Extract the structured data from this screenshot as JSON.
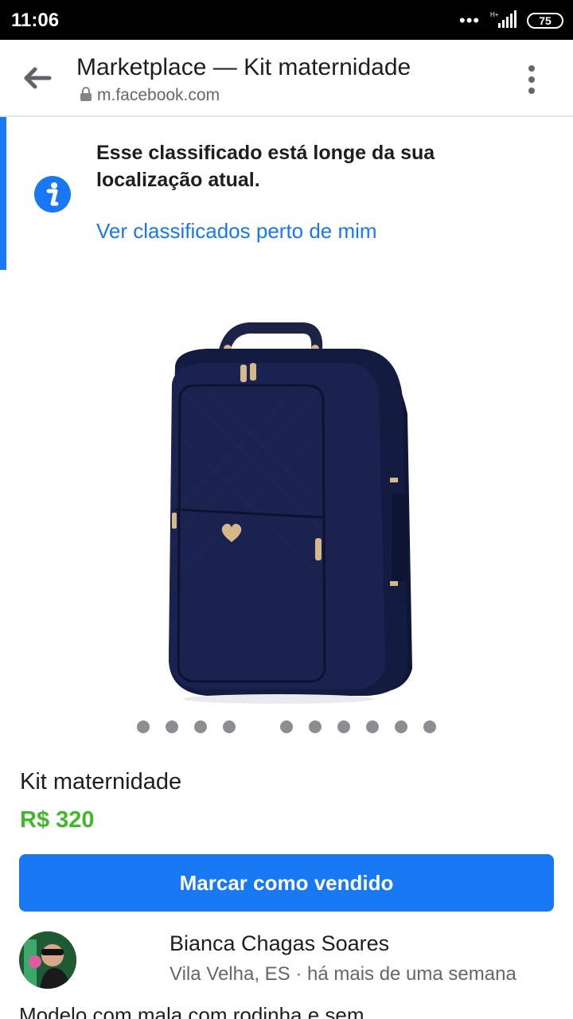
{
  "status": {
    "time": "11:06",
    "dots": "•••",
    "network": "H+",
    "battery": "75"
  },
  "header": {
    "title": "Marketplace — Kit maternidade",
    "url": "m.facebook.com",
    "back_icon": "arrow-left-icon",
    "more_icon": "more-vertical-icon"
  },
  "notice": {
    "text": "Esse classificado está longe da sua localização atual.",
    "link": "Ver classificados perto de mim",
    "icon": "info-icon"
  },
  "gallery": {
    "image_subject": "navy-quilted-maternity-bag",
    "dot_count": 10,
    "active_dot": -1
  },
  "listing": {
    "title": "Kit maternidade",
    "price": "R$ 320",
    "mark_sold_label": "Marcar como vendido"
  },
  "seller": {
    "name": "Bianca Chagas Soares",
    "meta": "Vila Velha, ES · há mais de uma semana"
  },
  "description": "Modelo com mala com rodinha e sem",
  "colors": {
    "accent": "#1877f2",
    "price": "#42b72a",
    "secondary_text": "#65676b"
  }
}
